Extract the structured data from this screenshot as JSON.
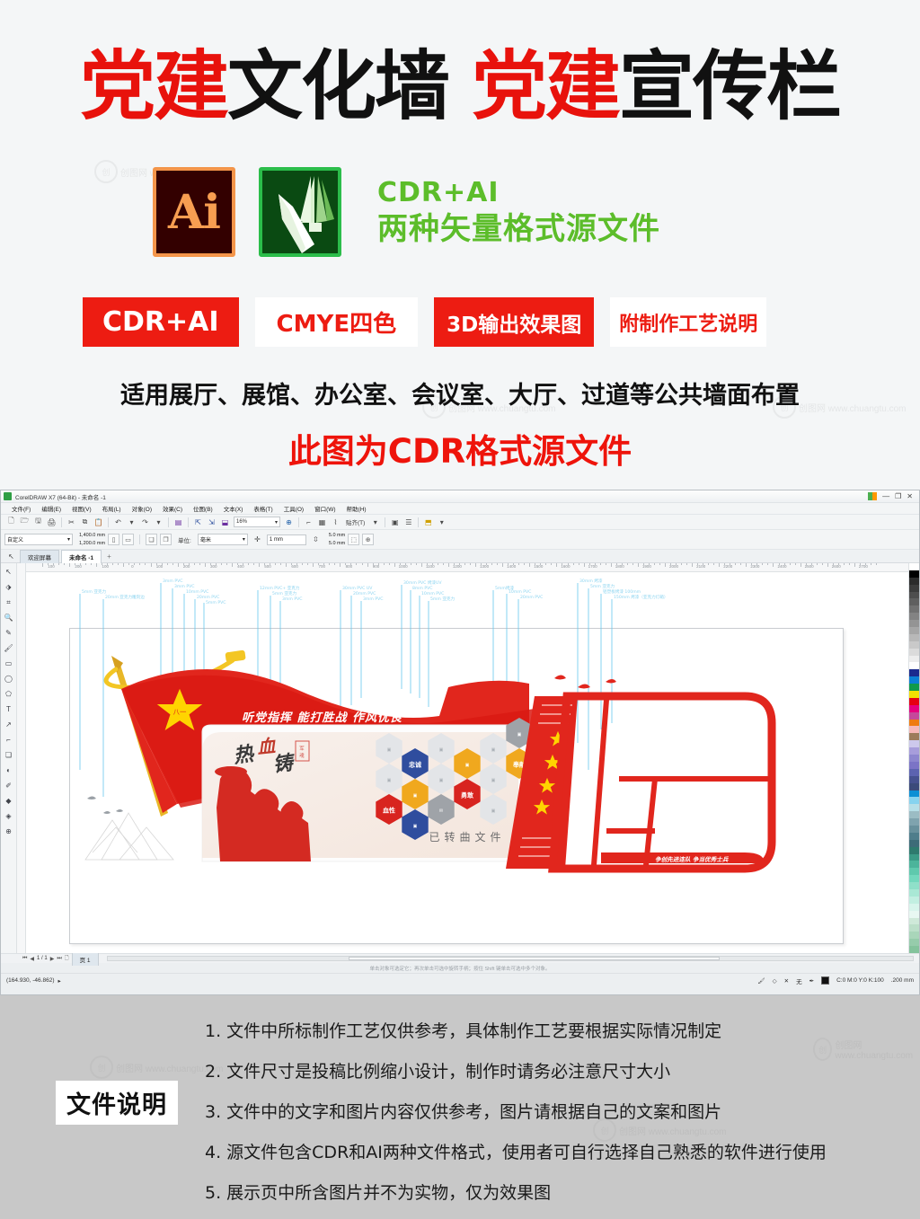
{
  "hero": {
    "title_parts": [
      {
        "text": "党建",
        "color": "red"
      },
      {
        "text": "文化墙",
        "color": "black"
      },
      {
        "text": "党建",
        "color": "red"
      },
      {
        "text": "宣传栏",
        "color": "black"
      }
    ],
    "ai_logo_label": "Ai",
    "cdr_logo_label": "CorelDRAW",
    "format_line1": "CDR+AI",
    "format_line2": "两种矢量格式源文件",
    "badges": [
      {
        "label": "CDR+AI",
        "style": "solid"
      },
      {
        "label": "CMYE四色",
        "style": "outline"
      },
      {
        "label": "3D输出效果图",
        "style": "solid"
      },
      {
        "label": "附制作工艺说明",
        "style": "outline"
      }
    ],
    "apply_line": "适用展厅、展馆、办公室、会议室、大厅、过道等公共墙面布置",
    "source_line": "此图为CDR格式源文件",
    "watermark_text": "创图网  www.chuangtu.com"
  },
  "coreldraw": {
    "title": "CorelDRAW X7 (64-Bit) - 未命名 -1",
    "window_buttons": [
      "—",
      "❐",
      "✕"
    ],
    "menus": [
      "文件(F)",
      "编辑(E)",
      "视图(V)",
      "布局(L)",
      "对象(O)",
      "效果(C)",
      "位图(B)",
      "文本(X)",
      "表格(T)",
      "工具(O)",
      "窗口(W)",
      "帮助(H)"
    ],
    "toolbar": {
      "zoom_value": "16%",
      "snap_label": "贴齐(T)",
      "icons": [
        "new-file-icon",
        "open-file-icon",
        "save-icon",
        "print-icon",
        "cut-icon",
        "copy-icon",
        "paste-icon",
        "undo-icon",
        "redo-icon",
        "import-icon",
        "export-icon",
        "publish-pdf-icon",
        "application-launcher-icon"
      ]
    },
    "property_bar": {
      "preset": "自定义",
      "width": "1,400.0 mm",
      "height": "1,200.0 mm",
      "units_label": "单位:",
      "units_value": "毫米",
      "nudge": "1 mm",
      "duplicate_x": "5.0 mm",
      "duplicate_y": "5.0 mm"
    },
    "tabs": [
      {
        "label": "欢迎屏幕",
        "active": false
      },
      {
        "label": "未命名 -1",
        "active": true
      }
    ],
    "tab_add": "+",
    "ruler_labels": [
      "100",
      "200",
      "100",
      "0",
      "100",
      "200",
      "300",
      "400",
      "500",
      "600",
      "700",
      "800",
      "900",
      "1000",
      "1100",
      "1200",
      "1300",
      "1400",
      "1500",
      "1600",
      "1700",
      "1800",
      "1900",
      "2000",
      "2100",
      "2200",
      "2300",
      "2400",
      "2500",
      "2600",
      "2700"
    ],
    "toolbox": [
      "pick-tool-icon",
      "shape-tool-icon",
      "crop-tool-icon",
      "zoom-tool-icon",
      "freehand-tool-icon",
      "artistic-media-icon",
      "rectangle-tool-icon",
      "ellipse-tool-icon",
      "polygon-tool-icon",
      "text-tool-icon",
      "parallel-dimension-icon",
      "connector-tool-icon",
      "drop-shadow-icon",
      "transparency-tool-icon",
      "color-eyedropper-icon",
      "fill-tool-icon",
      "interactive-fill-icon",
      "quick-customize-icon"
    ],
    "canvas": {
      "converted_note": "已转曲文件",
      "artwork": {
        "banner_slogan": "听党指挥  能打胜战  作风优良",
        "calligraphy": "热血铸",
        "seal_text": "军魂",
        "hexagons": [
          {
            "label": "忠诚",
            "color": "#2f4d9e"
          },
          {
            "label": "奉献",
            "color": "#f0a81e"
          },
          {
            "label": "勇敢",
            "color": "#e01b22"
          },
          {
            "label": "血性",
            "color": "#e01b22"
          }
        ],
        "bottom_slogan": "争创先进连队 争当优秀士兵",
        "star_char": "八一",
        "annotations": [
          "5mm 亚克力",
          "20mm 亚克力雕刻边",
          "3mm PVC",
          "8mm PVC",
          "20mm PVC",
          "5mm PVC",
          "12mm PVC+ 亚克力",
          "5mm 亚克力",
          "3mm PVC",
          "30mm PVC UV",
          "20mm PVC",
          "3mm PVC",
          "30mm PVC 烤漆UV",
          "8mm PVC",
          "10mm PVC",
          "5mm 亚克力",
          "5mm 烤漆",
          "10mm PVC",
          "20mm PVC",
          "3mm PVC",
          "30mm 烤漆",
          "5mm 亚克力",
          "铝塑板烤漆 100mm",
          "150mm 烤漆（亚克力灯箱）"
        ]
      }
    },
    "page_nav": {
      "page_counter": "1 / 1",
      "page_tab": "页 1"
    },
    "hint": "单击对象可选定它；再次单击可选中旋转手柄；按住 Shift 键单击可选中多个对象。",
    "status": {
      "coordinates": "(164.930, -46.862)",
      "outline_label": "无",
      "fill_value": "C:0 M:0 Y:0 K:100",
      "outline_width": ".200 mm"
    }
  },
  "footer": {
    "label": "文件说明",
    "notes": [
      "1. 文件中所标制作工艺仅供参考，具体制作工艺要根据实际情况制定",
      "2. 文件尺寸是投稿比例缩小设计，制作时请务必注意尺寸大小",
      "3. 文件中的文字和图片内容仅供参考，图片请根据自己的文案和图片",
      "4. 源文件包含CDR和AI两种文件格式，使用者可自行选择自己熟悉的软件进行使用",
      "5. 展示页中所含图片并不为实物，仅为效果图"
    ]
  },
  "colors": {
    "accent_red": "#ed1c12",
    "accent_green": "#5cbd2a",
    "footer_bg": "#c8c8c8",
    "artwork_red": "#e1261d",
    "artwork_yellow": "#ffd400"
  }
}
